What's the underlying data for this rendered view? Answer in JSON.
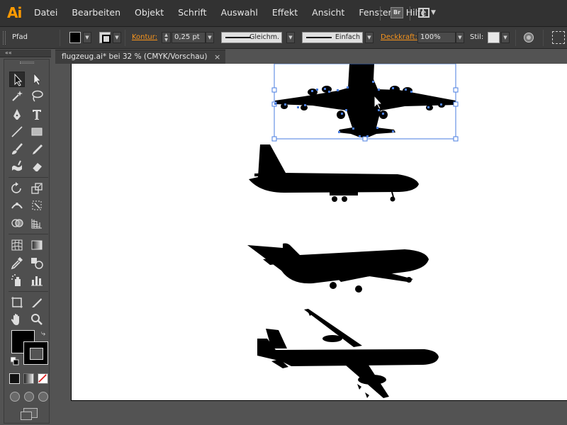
{
  "app": {
    "logo": "Ai"
  },
  "menubar": {
    "items": [
      "Datei",
      "Bearbeiten",
      "Objekt",
      "Schrift",
      "Auswahl",
      "Effekt",
      "Ansicht",
      "Fenster",
      "Hilfe"
    ],
    "bridge_label": "Br"
  },
  "controlbar": {
    "selection_type": "Pfad",
    "stroke_label": "Kontur:",
    "stroke_weight": "0,25 pt",
    "variable_width_profile": "Gleichm.",
    "brush_definition": "Einfach",
    "opacity_label": "Deckkraft:",
    "opacity_value": "100%",
    "style_label": "Stil:"
  },
  "tools_panel": {
    "collapse_glyph": "««"
  },
  "document": {
    "tab_title": "flugzeug.ai* bei 32 % (CMYK/Vorschau)",
    "tab_close": "×"
  },
  "colors": {
    "accent": "#f7941d",
    "selection": "#4a7ee0",
    "artwork": "#000000"
  },
  "artwork": {
    "objects": [
      {
        "name": "airplane-top-view",
        "selected": true
      },
      {
        "name": "airplane-side-view",
        "selected": false
      },
      {
        "name": "airplane-climbing",
        "selected": false
      },
      {
        "name": "airplane-perspective",
        "selected": false
      }
    ]
  }
}
